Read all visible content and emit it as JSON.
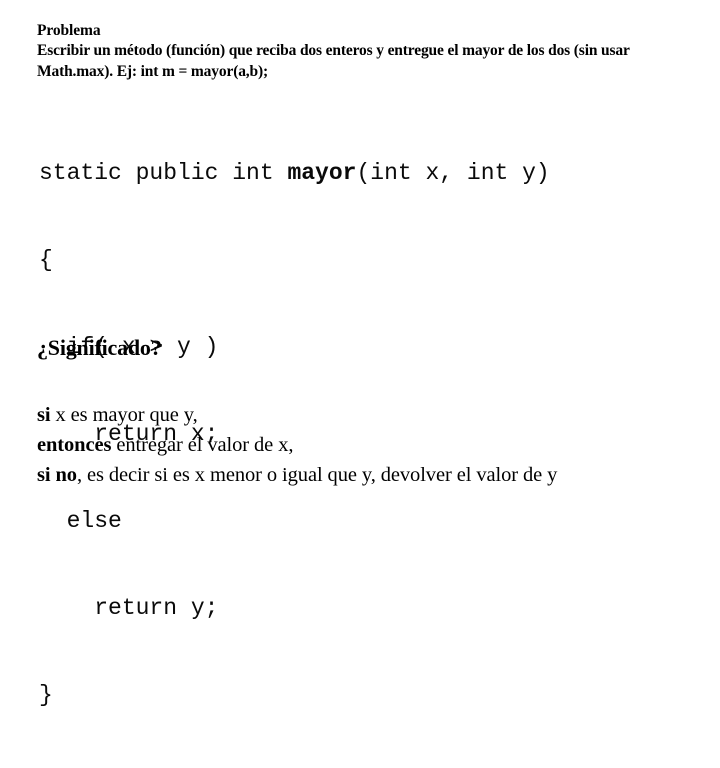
{
  "slide": {
    "background_color": "#ffffff",
    "text_color": "#000000"
  },
  "problem": {
    "heading": "Problema",
    "description": "Escribir un método (función) que reciba dos enteros y entregue el mayor de los dos (sin usar Math.max). Ej: int m = mayor(a,b);"
  },
  "code": {
    "language": "java",
    "signature_prefix": "static public int ",
    "signature_name": "mayor",
    "signature_suffix": "(int x, int y)",
    "lines": [
      "{",
      "  if( x > y )",
      "    return x;",
      "  else",
      "    return y;",
      "}"
    ]
  },
  "significado": {
    "heading": "¿Significado?"
  },
  "explanation": {
    "lines": [
      {
        "keyword": "si",
        "rest": " x es mayor que y,"
      },
      {
        "keyword": "entonces",
        "rest": " entregar el valor de x,"
      },
      {
        "keyword": "si no",
        "rest": ", es decir si es x menor o igual que y, devolver el valor de y"
      }
    ]
  }
}
